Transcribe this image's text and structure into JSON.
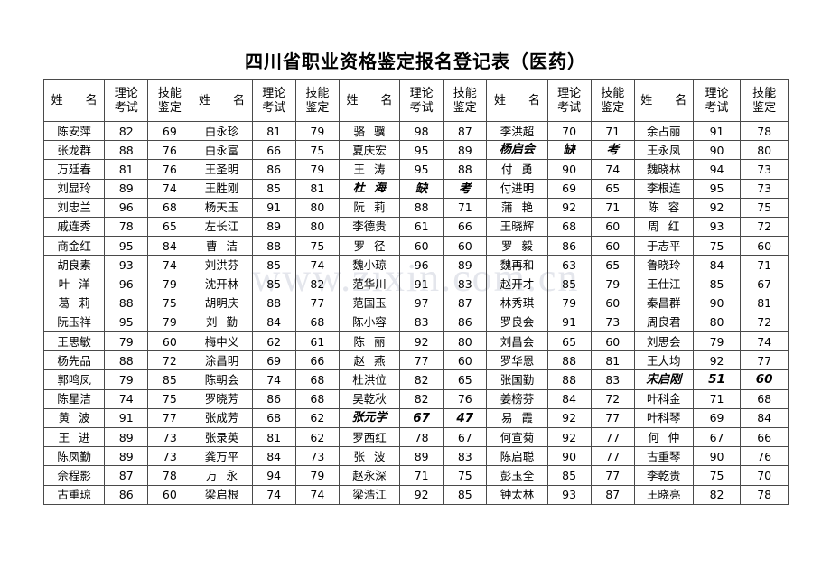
{
  "document": {
    "title": "四川省职业资格鉴定报名登记表（医药）",
    "watermark": "www.zixin.com.cn"
  },
  "table": {
    "headers": {
      "name": "姓　名",
      "theory_line1": "理论",
      "theory_line2": "考试",
      "skill_line1": "技能",
      "skill_line2": "鉴定"
    },
    "absent_marker": {
      "part1": "缺",
      "part2": "考"
    },
    "groups": [
      {
        "index": 1,
        "rows": [
          {
            "name": "陈安萍",
            "theory": "82",
            "skill": "69",
            "red": false
          },
          {
            "name": "张龙群",
            "theory": "88",
            "skill": "76",
            "red": false
          },
          {
            "name": "万廷春",
            "theory": "81",
            "skill": "76",
            "red": false
          },
          {
            "name": "刘显玲",
            "theory": "89",
            "skill": "74",
            "red": false
          },
          {
            "name": "刘忠兰",
            "theory": "96",
            "skill": "68",
            "red": false
          },
          {
            "name": "戚连秀",
            "theory": "78",
            "skill": "65",
            "red": false
          },
          {
            "name": "商金红",
            "theory": "95",
            "skill": "84",
            "red": false
          },
          {
            "name": "胡良素",
            "theory": "93",
            "skill": "74",
            "red": false
          },
          {
            "name": "叶　洋",
            "theory": "96",
            "skill": "79",
            "red": false,
            "spaced": true
          },
          {
            "name": "葛　莉",
            "theory": "88",
            "skill": "75",
            "red": false,
            "spaced": true
          },
          {
            "name": "阮玉祥",
            "theory": "95",
            "skill": "79",
            "red": false
          },
          {
            "name": "王思敏",
            "theory": "79",
            "skill": "60",
            "red": false
          },
          {
            "name": "杨先品",
            "theory": "88",
            "skill": "72",
            "red": false
          },
          {
            "name": "郭鸣凤",
            "theory": "79",
            "skill": "85",
            "red": false
          },
          {
            "name": "陈星洁",
            "theory": "74",
            "skill": "75",
            "red": false
          },
          {
            "name": "黄　波",
            "theory": "91",
            "skill": "77",
            "red": false,
            "spaced": true
          },
          {
            "name": "王　进",
            "theory": "89",
            "skill": "73",
            "red": false,
            "spaced": true
          },
          {
            "name": "陈凤勤",
            "theory": "89",
            "skill": "73",
            "red": false
          },
          {
            "name": "佘程影",
            "theory": "87",
            "skill": "78",
            "red": false
          },
          {
            "name": "古重琼",
            "theory": "86",
            "skill": "60",
            "red": false
          }
        ]
      },
      {
        "index": 2,
        "rows": [
          {
            "name": "白永珍",
            "theory": "81",
            "skill": "79",
            "red": false
          },
          {
            "name": "白永富",
            "theory": "66",
            "skill": "75",
            "red": false
          },
          {
            "name": "王圣明",
            "theory": "86",
            "skill": "79",
            "red": false
          },
          {
            "name": "王胜刚",
            "theory": "85",
            "skill": "81",
            "red": false
          },
          {
            "name": "杨天玉",
            "theory": "91",
            "skill": "80",
            "red": false
          },
          {
            "name": "左长江",
            "theory": "89",
            "skill": "80",
            "red": false
          },
          {
            "name": "曹　洁",
            "theory": "88",
            "skill": "75",
            "red": false,
            "spaced": true
          },
          {
            "name": "刘洪芬",
            "theory": "85",
            "skill": "74",
            "red": false
          },
          {
            "name": "沈开林",
            "theory": "85",
            "skill": "82",
            "red": false
          },
          {
            "name": "胡明庆",
            "theory": "88",
            "skill": "77",
            "red": false
          },
          {
            "name": "刘　勤",
            "theory": "84",
            "skill": "68",
            "red": false,
            "spaced": true
          },
          {
            "name": "梅中义",
            "theory": "62",
            "skill": "61",
            "red": false
          },
          {
            "name": "涂昌明",
            "theory": "69",
            "skill": "66",
            "red": false
          },
          {
            "name": "陈朝会",
            "theory": "74",
            "skill": "68",
            "red": false
          },
          {
            "name": "罗晓芳",
            "theory": "86",
            "skill": "68",
            "red": false
          },
          {
            "name": "张成芳",
            "theory": "68",
            "skill": "62",
            "red": false
          },
          {
            "name": "张录英",
            "theory": "81",
            "skill": "62",
            "red": false
          },
          {
            "name": "龚万平",
            "theory": "84",
            "skill": "73",
            "red": false
          },
          {
            "name": "万　永",
            "theory": "94",
            "skill": "79",
            "red": false,
            "spaced": true
          },
          {
            "name": "梁启根",
            "theory": "74",
            "skill": "74",
            "red": false
          }
        ]
      },
      {
        "index": 3,
        "rows": [
          {
            "name": "骆　骥",
            "theory": "98",
            "skill": "87",
            "red": false,
            "spaced": true
          },
          {
            "name": "夏庆宏",
            "theory": "95",
            "skill": "89",
            "red": false
          },
          {
            "name": "王　涛",
            "theory": "95",
            "skill": "88",
            "red": false,
            "spaced": true
          },
          {
            "name": "杜　海",
            "theory": "缺",
            "skill": "考",
            "red": true,
            "spaced": true
          },
          {
            "name": "阮　莉",
            "theory": "88",
            "skill": "71",
            "red": false,
            "spaced": true
          },
          {
            "name": "李德贵",
            "theory": "61",
            "skill": "66",
            "red": false
          },
          {
            "name": "罗　径",
            "theory": "60",
            "skill": "60",
            "red": false,
            "spaced": true
          },
          {
            "name": "魏小琼",
            "theory": "96",
            "skill": "89",
            "red": false
          },
          {
            "name": "范华川",
            "theory": "91",
            "skill": "83",
            "red": false
          },
          {
            "name": "范国玉",
            "theory": "97",
            "skill": "87",
            "red": false
          },
          {
            "name": "陈小容",
            "theory": "83",
            "skill": "86",
            "red": false
          },
          {
            "name": "陈　丽",
            "theory": "92",
            "skill": "80",
            "red": false,
            "spaced": true
          },
          {
            "name": "赵　燕",
            "theory": "77",
            "skill": "60",
            "red": false,
            "spaced": true
          },
          {
            "name": "杜洪位",
            "theory": "82",
            "skill": "65",
            "red": false
          },
          {
            "name": "吴乾秋",
            "theory": "82",
            "skill": "76",
            "red": false
          },
          {
            "name": "张元学",
            "theory": "67",
            "skill": "47",
            "red": true
          },
          {
            "name": "罗西红",
            "theory": "78",
            "skill": "67",
            "red": false
          },
          {
            "name": "张　波",
            "theory": "89",
            "skill": "83",
            "red": false,
            "spaced": true
          },
          {
            "name": "赵永深",
            "theory": "71",
            "skill": "75",
            "red": false
          },
          {
            "name": "梁浩江",
            "theory": "92",
            "skill": "85",
            "red": false
          }
        ]
      },
      {
        "index": 4,
        "rows": [
          {
            "name": "李洪超",
            "theory": "70",
            "skill": "71",
            "red": false
          },
          {
            "name": "杨启会",
            "theory": "缺",
            "skill": "考",
            "red": true
          },
          {
            "name": "付　勇",
            "theory": "90",
            "skill": "74",
            "red": false,
            "spaced": true
          },
          {
            "name": "付进明",
            "theory": "69",
            "skill": "65",
            "red": false
          },
          {
            "name": "蒲　艳",
            "theory": "92",
            "skill": "71",
            "red": false,
            "spaced": true
          },
          {
            "name": "王晓辉",
            "theory": "68",
            "skill": "60",
            "red": false
          },
          {
            "name": "罗　毅",
            "theory": "86",
            "skill": "60",
            "red": false,
            "spaced": true
          },
          {
            "name": "魏再和",
            "theory": "63",
            "skill": "65",
            "red": false
          },
          {
            "name": "赵开才",
            "theory": "85",
            "skill": "79",
            "red": false
          },
          {
            "name": "林秀琪",
            "theory": "79",
            "skill": "60",
            "red": false
          },
          {
            "name": "罗良会",
            "theory": "91",
            "skill": "73",
            "red": false
          },
          {
            "name": "刘昌会",
            "theory": "65",
            "skill": "60",
            "red": false
          },
          {
            "name": "罗华恩",
            "theory": "88",
            "skill": "81",
            "red": false
          },
          {
            "name": "张国勤",
            "theory": "88",
            "skill": "83",
            "red": false
          },
          {
            "name": "姜榜芬",
            "theory": "84",
            "skill": "72",
            "red": false
          },
          {
            "name": "易　霞",
            "theory": "92",
            "skill": "77",
            "red": false,
            "spaced": true
          },
          {
            "name": "何宣菊",
            "theory": "92",
            "skill": "77",
            "red": false
          },
          {
            "name": "陈启聪",
            "theory": "90",
            "skill": "77",
            "red": false
          },
          {
            "name": "彭玉全",
            "theory": "85",
            "skill": "77",
            "red": false
          },
          {
            "name": "钟太林",
            "theory": "93",
            "skill": "87",
            "red": false
          }
        ]
      },
      {
        "index": 5,
        "rows": [
          {
            "name": "余占丽",
            "theory": "91",
            "skill": "78",
            "red": false
          },
          {
            "name": "王永凤",
            "theory": "90",
            "skill": "80",
            "red": false
          },
          {
            "name": "魏晓林",
            "theory": "94",
            "skill": "73",
            "red": false
          },
          {
            "name": "李根连",
            "theory": "95",
            "skill": "73",
            "red": false
          },
          {
            "name": "陈　容",
            "theory": "92",
            "skill": "75",
            "red": false,
            "spaced": true
          },
          {
            "name": "周　红",
            "theory": "93",
            "skill": "72",
            "red": false,
            "spaced": true
          },
          {
            "name": "于志平",
            "theory": "75",
            "skill": "60",
            "red": false
          },
          {
            "name": "鲁晓玲",
            "theory": "84",
            "skill": "71",
            "red": false
          },
          {
            "name": "王仕江",
            "theory": "85",
            "skill": "67",
            "red": false
          },
          {
            "name": "秦昌群",
            "theory": "90",
            "skill": "81",
            "red": false
          },
          {
            "name": "周良君",
            "theory": "80",
            "skill": "72",
            "red": false
          },
          {
            "name": "刘思会",
            "theory": "79",
            "skill": "74",
            "red": false
          },
          {
            "name": "王大均",
            "theory": "92",
            "skill": "77",
            "red": false
          },
          {
            "name": "宋启刚",
            "theory": "51",
            "skill": "60",
            "red": true
          },
          {
            "name": "叶科金",
            "theory": "71",
            "skill": "68",
            "red": false
          },
          {
            "name": "叶科琴",
            "theory": "69",
            "skill": "84",
            "red": false
          },
          {
            "name": "何　仲",
            "theory": "67",
            "skill": "66",
            "red": false,
            "spaced": true
          },
          {
            "name": "古重琴",
            "theory": "90",
            "skill": "76",
            "red": false
          },
          {
            "name": "李乾贵",
            "theory": "75",
            "skill": "70",
            "red": false
          },
          {
            "name": "王晓亮",
            "theory": "82",
            "skill": "78",
            "red": false
          }
        ]
      }
    ]
  }
}
